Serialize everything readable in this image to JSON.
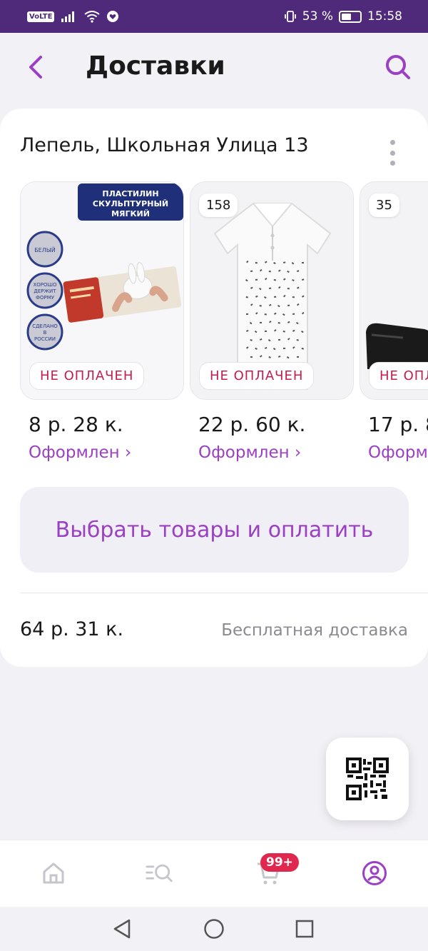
{
  "status_bar": {
    "network_label": "VoLTE",
    "battery_percent": "53 %",
    "battery_level": 0.53,
    "time": "15:58"
  },
  "header": {
    "title": "Доставки",
    "back_icon": "chevron-left-icon",
    "search_icon": "search-icon"
  },
  "delivery": {
    "address": "Лепель, Школьная Улица 13",
    "items": [
      {
        "product_name": "ПЛАСТИЛИН СКУЛЬПТУРНЫЙ МЯГКИЙ",
        "product_tags": [
          "БЕЛЫЙ",
          "ХОРОШО ДЕРЖИТ ФОРМУ",
          "СДЕЛАНО В РОССИИ"
        ],
        "quantity_badge": "",
        "status": "НЕ ОПЛАЧЕН",
        "price": "8 р. 28 к.",
        "order_link": "Оформлен ›"
      },
      {
        "product_name": "",
        "product_tags": [],
        "quantity_badge": "158",
        "status": "НЕ ОПЛАЧЕН",
        "price": "22 р. 60 к.",
        "order_link": "Оформлен ›"
      },
      {
        "product_name": "",
        "product_tags": [],
        "quantity_badge": "35",
        "status": "НЕ ОПЛАЧЕН",
        "price": "17 р. 8",
        "order_link": "Оформлен"
      }
    ],
    "pay_button": "Выбрать товары и оплатить",
    "total": "64 р. 31 к.",
    "delivery_note": "Бесплатная доставка"
  },
  "qr_button": {
    "icon": "qr-code-icon"
  },
  "bottom_nav": {
    "items": [
      "home-icon",
      "catalog-search-icon",
      "cart-icon",
      "profile-icon"
    ],
    "cart_badge": "99+",
    "active_item": "profile-icon"
  },
  "system_nav": {
    "items": [
      "back-triangle-icon",
      "home-circle-icon",
      "recents-square-icon"
    ]
  },
  "colors": {
    "accent": "#9b3fc4",
    "status_bar": "#4f2a7a",
    "unpaid": "#c21d4d",
    "badge": "#e0284f"
  }
}
